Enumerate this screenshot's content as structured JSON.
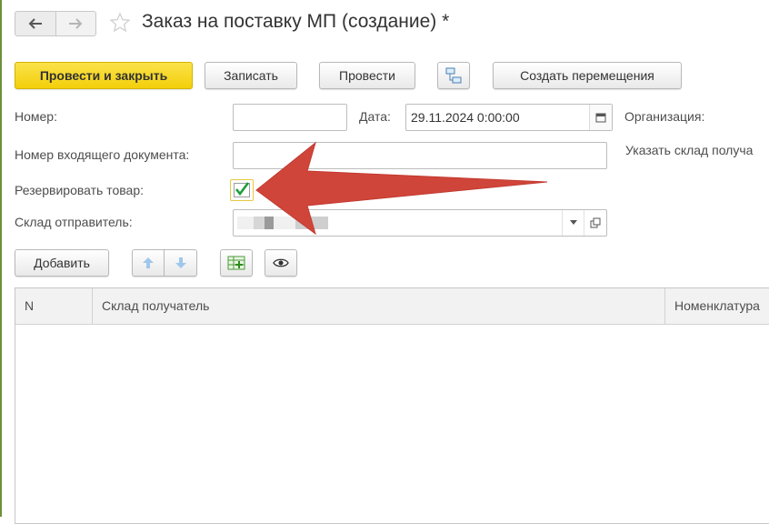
{
  "window": {
    "title": "Заказ на поставку МП (создание) *"
  },
  "toolbar": {
    "post_close_label": "Провести и закрыть",
    "write_label": "Записать",
    "post_label": "Провести",
    "create_moves_label": "Создать перемещения"
  },
  "form": {
    "number_label": "Номер:",
    "number_value": "",
    "date_label": "Дата:",
    "date_value": "29.11.2024  0:00:00",
    "org_label": "Организация:",
    "incoming_number_label": "Номер входящего документа:",
    "incoming_number_value": "",
    "receiver_warehouse_hint": "Указать склад получа",
    "reserve_label": "Резервировать товар:",
    "reserve_checked": true,
    "sender_warehouse_label": "Склад отправитель:"
  },
  "table_toolbar": {
    "add_label": "Добавить"
  },
  "table": {
    "columns": [
      "N",
      "Склад получатель",
      "Номенклатура"
    ],
    "rows": []
  },
  "colors": {
    "primary_button": "#f5d30f",
    "checkmark": "#1a9e3a",
    "arrow": "#d0453a"
  }
}
